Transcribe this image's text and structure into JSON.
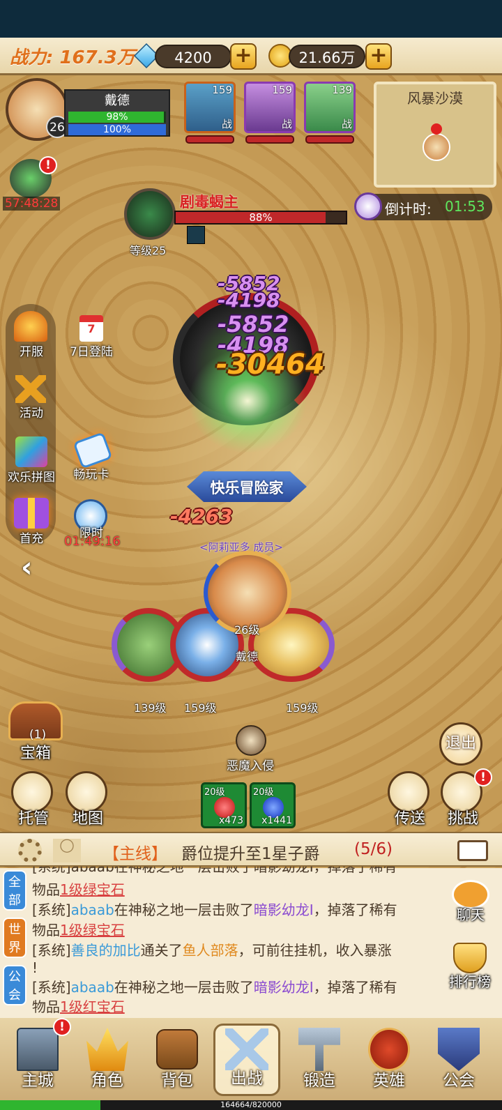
{
  "header": {
    "power_label": "战力: 167.3万",
    "diamonds": "4200",
    "gold": "21.66万"
  },
  "player": {
    "name": "戴德",
    "level": "26",
    "hp_percent": "98%",
    "mp_percent": "100%",
    "hp_fill": 0.98,
    "mp_fill": 1.0
  },
  "heroes": [
    {
      "level": "159",
      "tag": "战"
    },
    {
      "level": "159",
      "tag": "战"
    },
    {
      "level": "139",
      "tag": "战"
    }
  ],
  "minimap": {
    "title": "风暴沙漠"
  },
  "event_timer": "57:48:28",
  "countdown": {
    "label": "倒计时:",
    "value": "01:53"
  },
  "boss": {
    "name": "剧毒蝎主",
    "hp_percent": "88%",
    "hp_fill": 0.88,
    "level_label": "等级25"
  },
  "left_menu": [
    {
      "label": "开服"
    },
    {
      "label": "7日登陆"
    },
    {
      "label": "活动"
    },
    {
      "label": "欢乐拼图"
    },
    {
      "label": "畅玩卡"
    },
    {
      "label": "首充"
    },
    {
      "label": "限时"
    }
  ],
  "limited_timer": "01:49:16",
  "damage_numbers": [
    "-5852",
    "-4198",
    "-5852",
    "-4198",
    "-30464",
    "-4263"
  ],
  "guild": {
    "banner": "快乐冒险家",
    "player_title": "<阿莉亚多 成员>"
  },
  "party": [
    {
      "label": "26级",
      "name": "戴德"
    },
    {
      "label": "139级"
    },
    {
      "label": "159级"
    },
    {
      "label": "159级"
    }
  ],
  "treasure": {
    "count": "(1)",
    "label": "宝箱"
  },
  "demon_invasion": "恶魔入侵",
  "exit_label": "退出",
  "buttons": {
    "auto": "托管",
    "map": "地图",
    "teleport": "传送",
    "challenge": "挑战"
  },
  "potions": [
    {
      "level": "20级",
      "count": "x473"
    },
    {
      "level": "20级",
      "count": "x1441"
    }
  ],
  "quest": {
    "tag": "【主线】",
    "text": "爵位提升至1星子爵",
    "progress": "(5/6)"
  },
  "chat_tabs": [
    "全部",
    "世界",
    "公会"
  ],
  "chat": {
    "partial_top": "[系统]abaab在神秘之地一层击败了暗影幼龙I，掉落了稀有",
    "lines": [
      {
        "prefix": "物品",
        "item": "1级绿宝石"
      },
      {
        "sys": "[系统]",
        "player": "abaab",
        "mid": "在神秘之地一层击败了",
        "mon": "暗影幼龙I",
        "end": "，掉落了稀有"
      },
      {
        "prefix": "物品",
        "item": "1级绿宝石"
      },
      {
        "sys": "[系统]",
        "player": "善良的加比",
        "mid": "通关了",
        "place": "鱼人部落",
        "end": "，可前往挂机，收入暴涨"
      },
      {
        "end": "!"
      },
      {
        "sys": "[系统]",
        "player": "abaab",
        "mid": "在神秘之地一层击败了",
        "mon": "暗影幼龙I",
        "end": "，掉落了稀有"
      },
      {
        "prefix": "物品",
        "item": "1级红宝石"
      }
    ]
  },
  "side_buttons": {
    "chat": "聊天",
    "ranking": "排行榜"
  },
  "nav": [
    {
      "label": "主城"
    },
    {
      "label": "角色"
    },
    {
      "label": "背包"
    },
    {
      "label": "出战"
    },
    {
      "label": "锻造"
    },
    {
      "label": "英雄"
    },
    {
      "label": "公会"
    }
  ],
  "xp": {
    "text": "164664/820000",
    "fill": 0.2
  },
  "colors": {
    "accent": "#e0701b",
    "hp": "#2fb52f",
    "mp": "#2f6bd8",
    "boss_hp": "#c0282a"
  }
}
